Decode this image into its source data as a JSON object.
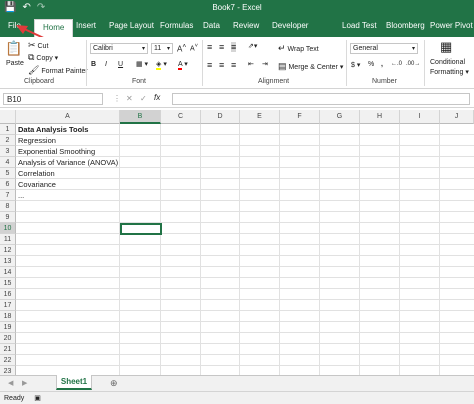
{
  "title_bar": {
    "title": "Book7 - Excel"
  },
  "tabs": [
    "File",
    "Home",
    "Insert",
    "Page Layout",
    "Formulas",
    "Data",
    "Review",
    "Developer",
    "Load Test",
    "Bloomberg",
    "Power Pivot"
  ],
  "active_tab": "Home",
  "ribbon": {
    "clipboard": {
      "paste": "Paste",
      "cut": "Cut",
      "copy": "Copy",
      "format_painter": "Format Painter",
      "label": "Clipboard"
    },
    "font": {
      "font_name": "Calibri",
      "font_size": "11",
      "label": "Font",
      "bold": "B",
      "italic": "I",
      "underline": "U"
    },
    "alignment": {
      "wrap_text": "Wrap Text",
      "merge_center": "Merge & Center",
      "label": "Alignment"
    },
    "number": {
      "format": "General",
      "label": "Number",
      "percent": "%",
      "comma": ",",
      "currency": "$"
    },
    "styles": {
      "conditional_formatting": "Conditional",
      "conditional_formatting_2": "Formatting"
    }
  },
  "formula_bar": {
    "name_box": "B10",
    "fx": "fx"
  },
  "columns": [
    "A",
    "B",
    "C",
    "D",
    "E",
    "F",
    "G",
    "H",
    "I",
    "J"
  ],
  "selected_column": "B",
  "selected_row": 10,
  "rows": [
    "1",
    "2",
    "3",
    "4",
    "5",
    "6",
    "7",
    "8",
    "9",
    "10",
    "11",
    "12",
    "13",
    "14",
    "15",
    "16",
    "17",
    "18",
    "19",
    "20",
    "21",
    "22",
    "23"
  ],
  "cells": [
    {
      "row": 1,
      "text": "Data Analysis Tools",
      "bold": true
    },
    {
      "row": 2,
      "text": "Regression"
    },
    {
      "row": 3,
      "text": "Exponential Smoothing"
    },
    {
      "row": 4,
      "text": "Analysis of Variance (ANOVA)"
    },
    {
      "row": 5,
      "text": "Correlation"
    },
    {
      "row": 6,
      "text": "Covariance"
    },
    {
      "row": 7,
      "text": "..."
    }
  ],
  "sheet_tabs": [
    "Sheet1"
  ],
  "status": "Ready",
  "colors": {
    "excel_green": "#217346",
    "arrow": "#e03a3a"
  }
}
